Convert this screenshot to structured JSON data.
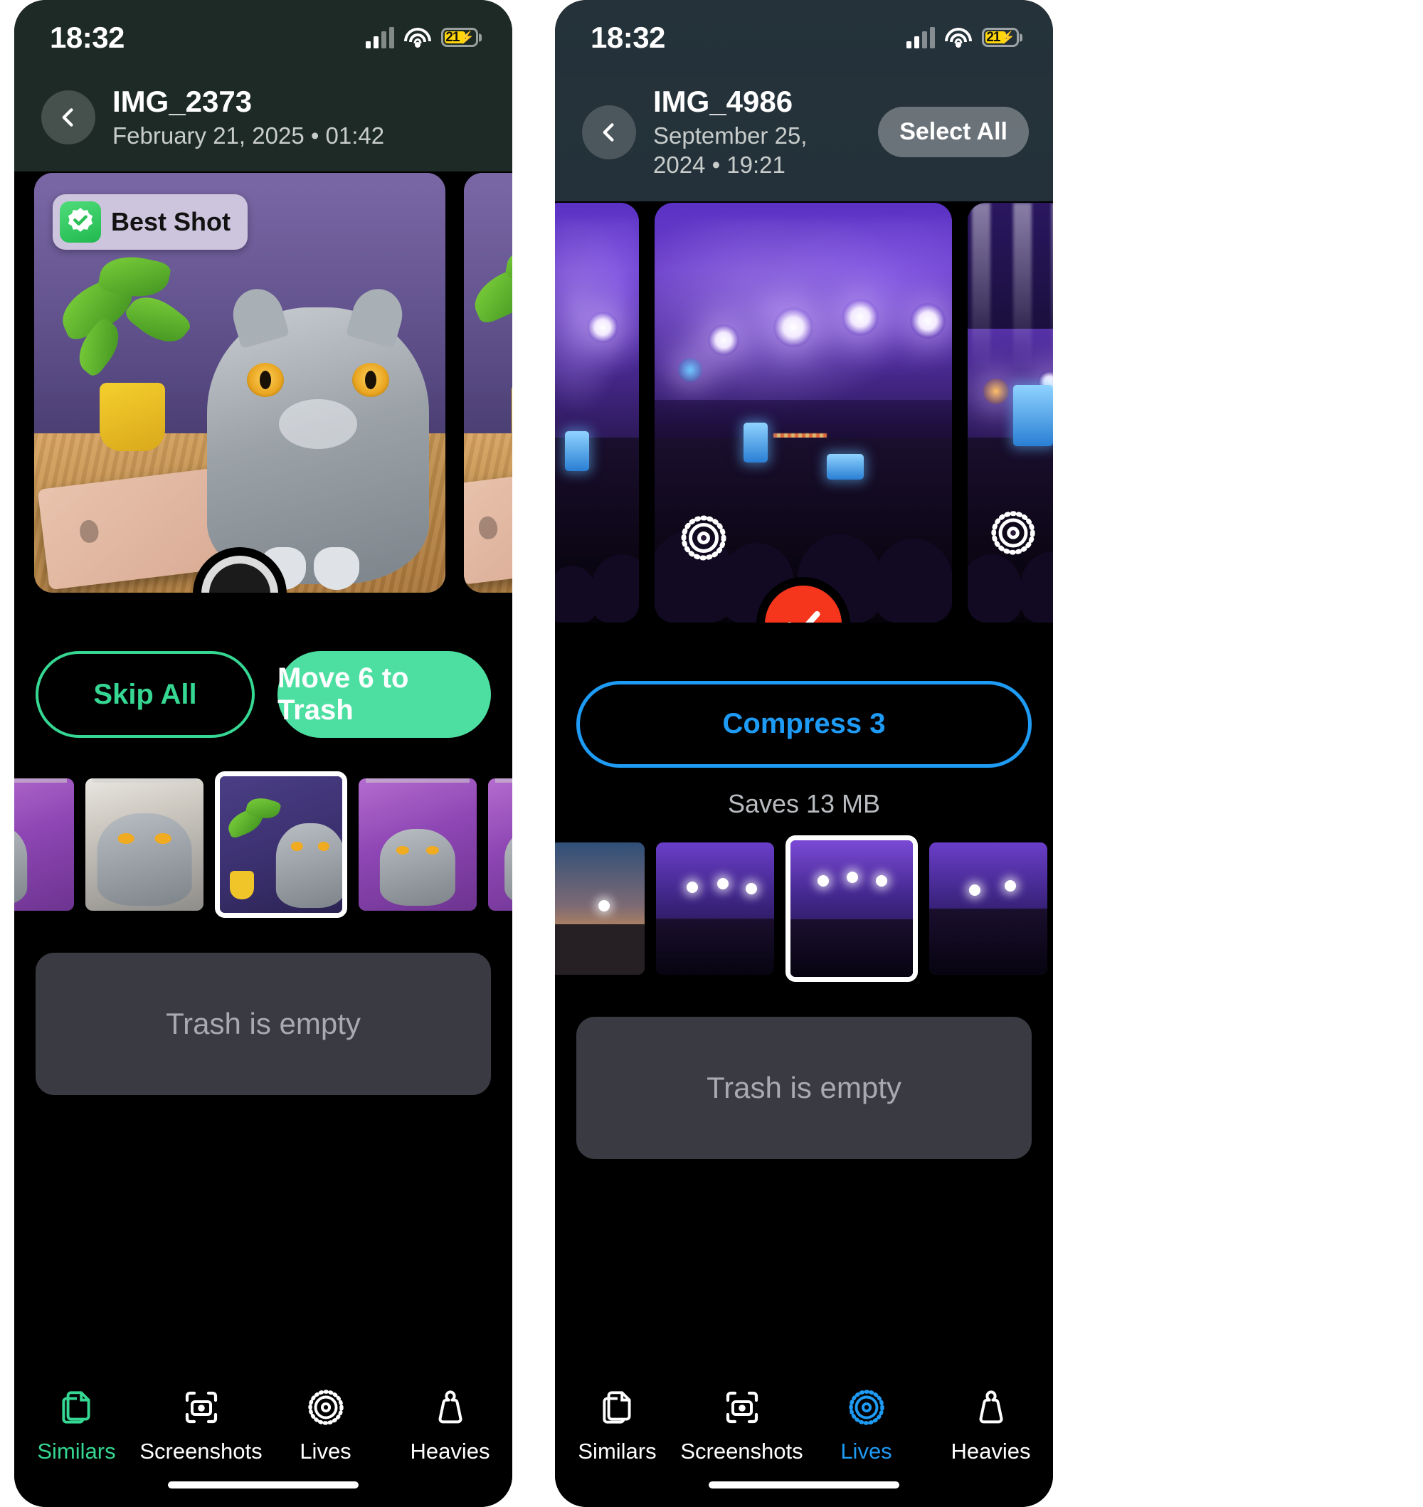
{
  "panels": [
    {
      "id": "similars-panel",
      "status": {
        "time": "18:32",
        "battery_level": "21",
        "battery_charging_glyph": "⚡",
        "signal_icon": "cellular-signal-icon",
        "wifi_icon": "wifi-icon"
      },
      "header": {
        "back_icon": "chevron-left-icon",
        "title": "IMG_2373",
        "subtitle": "February 21, 2025 • 01:42",
        "select_all_label": null
      },
      "hero": {
        "best_shot_label": "Best Shot",
        "best_shot_icon": "verified-seal-icon",
        "primary_selected": false,
        "secondary_selected": true,
        "live_badge": false
      },
      "actions": {
        "primary_label": "Skip All",
        "secondary_label": "Move 6 to Trash",
        "saves_label": null
      },
      "trash": {
        "label": "Trash is empty"
      },
      "filmstrip": {
        "selected_index": 2
      },
      "tabs": [
        {
          "label": "Similars",
          "icon": "stacked-photos-icon",
          "active": true
        },
        {
          "label": "Screenshots",
          "icon": "camera-frame-icon",
          "active": false
        },
        {
          "label": "Lives",
          "icon": "live-photo-icon",
          "active": false
        },
        {
          "label": "Heavies",
          "icon": "weight-icon",
          "active": false
        }
      ],
      "accent": "#35d792"
    },
    {
      "id": "lives-panel",
      "status": {
        "time": "18:32",
        "battery_level": "21",
        "battery_charging_glyph": "⚡",
        "signal_icon": "cellular-signal-icon",
        "wifi_icon": "wifi-icon"
      },
      "header": {
        "back_icon": "chevron-left-icon",
        "title": "IMG_4986",
        "subtitle": "September 25, 2024 • 19:21",
        "select_all_label": "Select All"
      },
      "hero": {
        "best_shot_label": null,
        "best_shot_icon": null,
        "primary_selected": true,
        "secondary_selected": false,
        "live_badge": true
      },
      "actions": {
        "primary_label": "Compress 3",
        "secondary_label": null,
        "saves_label": "Saves 13 MB"
      },
      "trash": {
        "label": "Trash is empty"
      },
      "filmstrip": {
        "selected_index": 2
      },
      "tabs": [
        {
          "label": "Similars",
          "icon": "stacked-photos-icon",
          "active": false
        },
        {
          "label": "Screenshots",
          "icon": "camera-frame-icon",
          "active": false
        },
        {
          "label": "Lives",
          "icon": "live-photo-icon",
          "active": true
        },
        {
          "label": "Heavies",
          "icon": "weight-icon",
          "active": false
        }
      ],
      "accent": "#1e9bf5"
    }
  ],
  "colors": {
    "green_accent": "#35d792",
    "green_fill": "#4ddfa1",
    "blue_accent": "#1e9bf5",
    "selected_red": "#f5361d",
    "battery_yellow": "#ffd60a",
    "trash_bar": "#3a3a42"
  }
}
